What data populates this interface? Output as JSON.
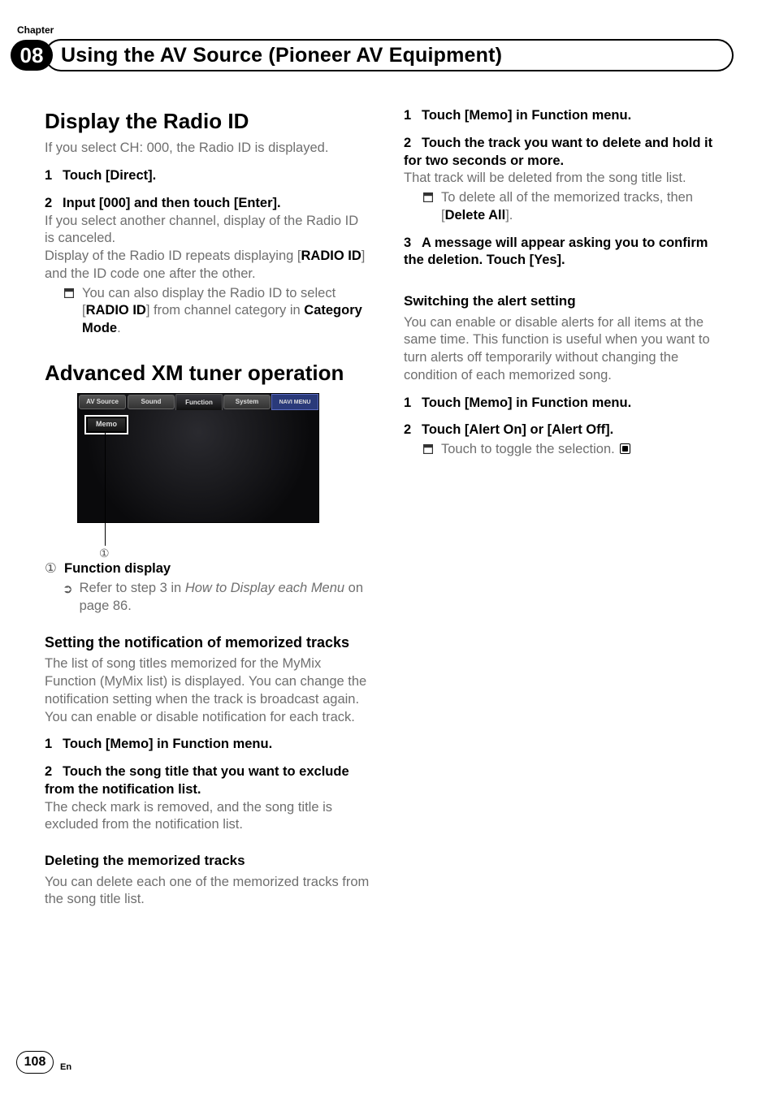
{
  "header": {
    "chapter_label": "Chapter",
    "chapter_number": "08",
    "title": "Using the AV Source (Pioneer AV Equipment)"
  },
  "left": {
    "h1": "Display the Radio ID",
    "p1": "If you select CH: 000, the Radio ID is displayed.",
    "step1": "Touch [Direct].",
    "step2": "Input [000] and then touch [Enter].",
    "p2": "If you select another channel, display of the Radio ID is canceled.",
    "p3a": "Display of the Radio ID repeats displaying [",
    "p3b": "RADIO ID",
    "p3c": "] and the ID code one after the other.",
    "bullet1a": "You can also display the Radio ID to select [",
    "bullet1b": "RADIO ID",
    "bullet1c": "] from channel category in ",
    "bullet1d": "Category Mode",
    "bullet1e": ".",
    "h1b": "Advanced XM tuner operation",
    "tabs": {
      "avsource": "AV Source",
      "sound": "Sound",
      "function": "Function",
      "system": "System",
      "navi": "NAVI MENU"
    },
    "memo_label": "Memo",
    "callout": "①",
    "li_num": "①",
    "li_label": "Function display",
    "ref1": "Refer to step 3 in ",
    "ref2": "How to Display each Menu",
    "ref3": " on page 86.",
    "h2a": "Setting the notification of memorized tracks",
    "p4": "The list of song titles memorized for the MyMix Function (MyMix list) is displayed. You can change the notification setting when the track is broadcast again. You can enable or disable notification for each track.",
    "step_m1": "Touch [Memo] in Function menu.",
    "step_m2": "Touch the song title that you want to exclude from the notification list.",
    "p5": "The check mark is removed, and the song title is excluded from the notification list.",
    "h3a": "Deleting the memorized tracks",
    "p6": "You can delete each one of the memorized tracks from the song title list."
  },
  "right": {
    "step_d1": "Touch [Memo] in Function menu.",
    "step_d2": "Touch the track you want to delete and hold it for two seconds or more.",
    "p7": "That track will be deleted from the song title list.",
    "bullet2a": "To delete all of the memorized tracks, then [",
    "bullet2b": "Delete All",
    "bullet2c": "].",
    "step_d3": "A message will appear asking you to confirm the deletion. Touch [Yes].",
    "h3b": "Switching the alert setting",
    "p8": "You can enable or disable alerts for all items at the same time. This function is useful when you want to turn alerts off temporarily without changing the condition of each memorized song.",
    "step_s1": "Touch [Memo] in Function menu.",
    "step_s2": "Touch [Alert On] or [Alert Off].",
    "bullet3": "Touch to toggle the selection."
  },
  "footer": {
    "page": "108",
    "lang": "En"
  }
}
